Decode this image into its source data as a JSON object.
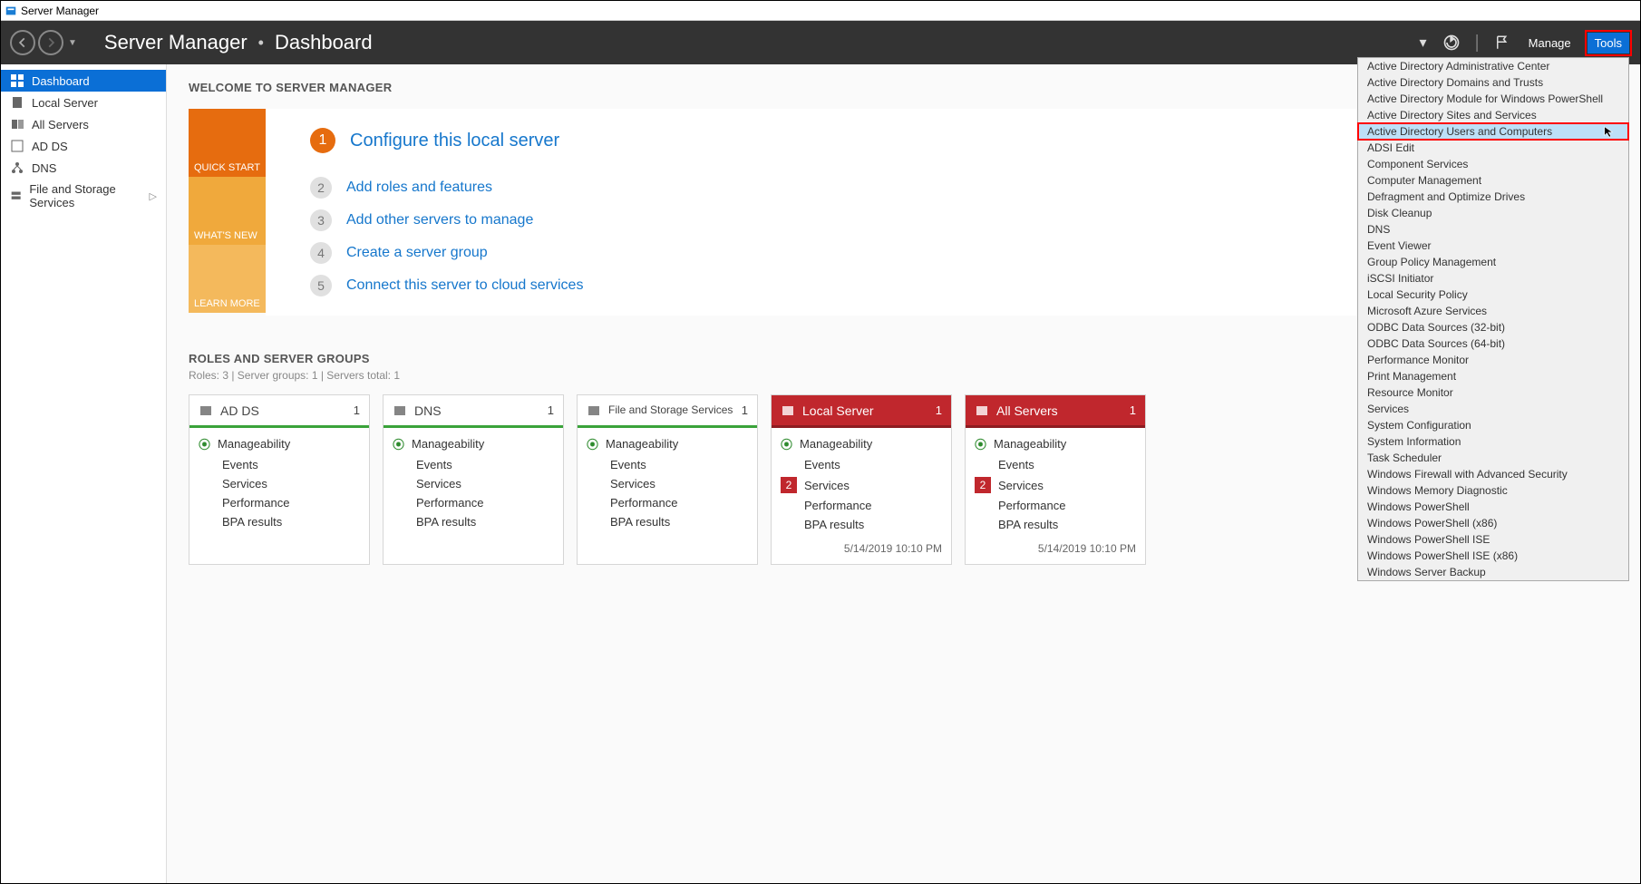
{
  "titlebar": {
    "title": "Server Manager"
  },
  "breadcrumb": {
    "app": "Server Manager",
    "page": "Dashboard"
  },
  "header": {
    "manage": "Manage",
    "tools": "Tools"
  },
  "sidebar": {
    "items": [
      {
        "label": "Dashboard"
      },
      {
        "label": "Local Server"
      },
      {
        "label": "All Servers"
      },
      {
        "label": "AD DS"
      },
      {
        "label": "DNS"
      },
      {
        "label": "File and Storage Services"
      }
    ]
  },
  "welcome": {
    "title": "WELCOME TO SERVER MANAGER",
    "tabs": {
      "quickstart": "QUICK START",
      "whatsnew": "WHAT'S NEW",
      "learnmore": "LEARN MORE"
    },
    "tasks": [
      {
        "n": "1",
        "label": "Configure this local server"
      },
      {
        "n": "2",
        "label": "Add roles and features"
      },
      {
        "n": "3",
        "label": "Add other servers to manage"
      },
      {
        "n": "4",
        "label": "Create a server group"
      },
      {
        "n": "5",
        "label": "Connect this server to cloud services"
      }
    ]
  },
  "roles": {
    "title": "ROLES AND SERVER GROUPS",
    "meta": "Roles: 3   |   Server groups: 1   |   Servers total: 1",
    "labels": {
      "manageability": "Manageability",
      "events": "Events",
      "services": "Services",
      "performance": "Performance",
      "bpa": "BPA results"
    },
    "tiles": [
      {
        "title": "AD DS",
        "count": "1",
        "red": false,
        "svc_alert": null,
        "timestamp": ""
      },
      {
        "title": "DNS",
        "count": "1",
        "red": false,
        "svc_alert": null,
        "timestamp": ""
      },
      {
        "title": "File and Storage Services",
        "count": "1",
        "red": false,
        "svc_alert": null,
        "timestamp": ""
      },
      {
        "title": "Local Server",
        "count": "1",
        "red": true,
        "svc_alert": "2",
        "timestamp": "5/14/2019 10:10 PM"
      },
      {
        "title": "All Servers",
        "count": "1",
        "red": true,
        "svc_alert": "2",
        "timestamp": "5/14/2019 10:10 PM"
      }
    ]
  },
  "tools_menu": {
    "items": [
      "Active Directory Administrative Center",
      "Active Directory Domains and Trusts",
      "Active Directory Module for Windows PowerShell",
      "Active Directory Sites and Services",
      "Active Directory Users and Computers",
      "ADSI Edit",
      "Component Services",
      "Computer Management",
      "Defragment and Optimize Drives",
      "Disk Cleanup",
      "DNS",
      "Event Viewer",
      "Group Policy Management",
      "iSCSI Initiator",
      "Local Security Policy",
      "Microsoft Azure Services",
      "ODBC Data Sources (32-bit)",
      "ODBC Data Sources (64-bit)",
      "Performance Monitor",
      "Print Management",
      "Resource Monitor",
      "Services",
      "System Configuration",
      "System Information",
      "Task Scheduler",
      "Windows Firewall with Advanced Security",
      "Windows Memory Diagnostic",
      "Windows PowerShell",
      "Windows PowerShell (x86)",
      "Windows PowerShell ISE",
      "Windows PowerShell ISE (x86)",
      "Windows Server Backup"
    ],
    "highlight_index": 4
  }
}
